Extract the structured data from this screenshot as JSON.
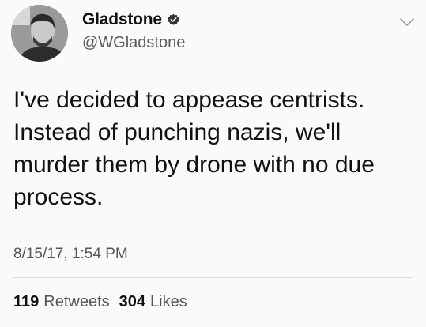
{
  "author": {
    "display_name": "Gladstone",
    "handle": "@WGladstone",
    "verified": true,
    "avatar_icon": "profile-photo"
  },
  "menu": {
    "icon": "chevron-down-icon"
  },
  "tweet": {
    "text": "I've decided to appease centrists.\nInstead of punching nazis, we'll\nmurder them by drone with no due\nprocess.",
    "timestamp": "8/15/17, 1:54 PM"
  },
  "stats": {
    "retweets_count": "119",
    "retweets_label": "Retweets",
    "likes_count": "304",
    "likes_label": "Likes"
  }
}
